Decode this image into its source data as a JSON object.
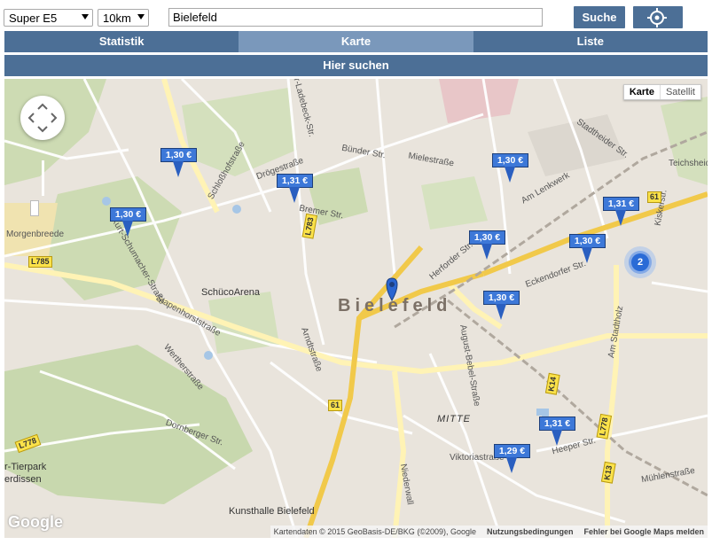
{
  "toolbar": {
    "fuel_selected": "Super E5",
    "radius_selected": "10km",
    "location_value": "Bielefeld",
    "search_label": "Suche"
  },
  "tabs": [
    {
      "label": "Statistik",
      "active": false
    },
    {
      "label": "Karte",
      "active": true
    },
    {
      "label": "Liste",
      "active": false
    }
  ],
  "here_label": "Hier suchen",
  "map": {
    "type_buttons": {
      "map": "Karte",
      "satellite": "Satellit"
    },
    "city": "Bielefeld",
    "prices": [
      {
        "price": "1,30 €"
      },
      {
        "price": "1,31 €"
      },
      {
        "price": "1,30 €"
      },
      {
        "price": "1,30 €"
      },
      {
        "price": "1,31 €"
      },
      {
        "price": "1,30 €"
      },
      {
        "price": "1,30 €"
      },
      {
        "price": "1,30 €"
      },
      {
        "price": "1,31 €"
      },
      {
        "price": "1,29 €"
      }
    ],
    "cluster_count": "2",
    "places": {
      "schueco": "SchücoArena",
      "kunsthalle": "Kunsthalle Bielefeld",
      "mitte": "MITTE",
      "tierpark": "r-Tierpark",
      "erdissen": "erdissen"
    },
    "streets": {
      "s1": "Schloßhofstraße",
      "s2": "Drögestraße",
      "s3": "Kurt-Schumacher-Straße",
      "s4": "Stapenhorststraße",
      "s5": "Wertherstraße",
      "s6": "Bremer Str.",
      "s7": "Herforder Str.",
      "s8": "Eckendorfer Str.",
      "s9": "Am Stadtholz",
      "s10": "August-Bebel-Straße",
      "s11": "Heeper Str.",
      "s12": "Viktoriastraße",
      "s13": "Niederwall",
      "s14": "Mühlenstraße",
      "s15": "Bünder Str.",
      "s16": "Mielestraße",
      "s17": "Stadtheider Str.",
      "s18": "Am Lenkwerk",
      "s19": "Dornberger Str.",
      "s20": "Artur-Ladebeck-Str.",
      "s21": "Morgenbreede",
      "s22": "Kiskerstr.",
      "s23": "Arndtstraße",
      "s24": "Teichsheide"
    },
    "shields": {
      "r1": "L785",
      "r2": "L783",
      "r3": "61",
      "r4": "61",
      "r5": "L778",
      "r6": "K13",
      "r7": "L778",
      "r8": "K14"
    }
  },
  "attribution": {
    "data": "Kartendaten © 2015 GeoBasis-DE/BKG (©2009), Google",
    "terms": "Nutzungsbedingungen",
    "report": "Fehler bei Google Maps melden"
  },
  "google_logo": "Google"
}
